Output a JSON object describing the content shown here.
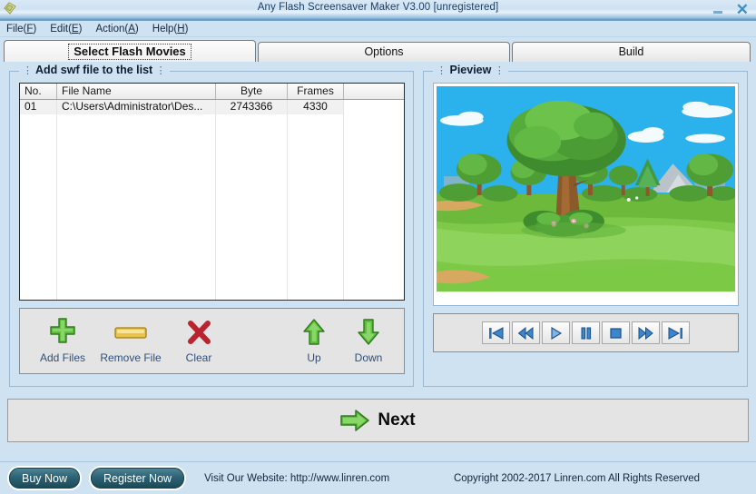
{
  "window": {
    "title": "Any Flash Screensaver Maker V3.00 [unregistered]",
    "app_icon": "app-diamond-icon",
    "minimize_icon": "minimize-icon",
    "close_icon": "close-icon"
  },
  "menubar": {
    "items": [
      {
        "label": "File",
        "accel": "F"
      },
      {
        "label": "Edit",
        "accel": "E"
      },
      {
        "label": "Action",
        "accel": "A"
      },
      {
        "label": "Help",
        "accel": "H"
      }
    ]
  },
  "tabs": [
    {
      "label": "Select Flash Movies",
      "active": true
    },
    {
      "label": "Options",
      "active": false
    },
    {
      "label": "Build",
      "active": false
    }
  ],
  "left_panel": {
    "group_title": "Add swf file to the list",
    "columns": [
      "No.",
      "File Name",
      "Byte",
      "Frames",
      ""
    ],
    "rows": [
      {
        "no": "01",
        "name": "C:\\Users\\Administrator\\Des...",
        "byte": "2743366",
        "frames": "4330"
      }
    ],
    "empty_row_count": 14,
    "toolbar": [
      {
        "label": "Add Files",
        "icon": "green-plus-icon"
      },
      {
        "label": "Remove File",
        "icon": "yellow-minus-icon"
      },
      {
        "label": "Clear",
        "icon": "red-x-icon"
      },
      {
        "label": "Up",
        "icon": "green-up-arrow-icon"
      },
      {
        "label": "Down",
        "icon": "green-down-arrow-icon"
      }
    ]
  },
  "right_panel": {
    "group_title": "Pieview",
    "preview_description": "Cartoon park scene with a large tree on a green lawn under a blue sky",
    "player_buttons": [
      {
        "icon": "skip-to-start-icon",
        "name": "first-frame-button"
      },
      {
        "icon": "rewind-icon",
        "name": "rewind-button"
      },
      {
        "icon": "play-icon",
        "name": "play-button"
      },
      {
        "icon": "pause-icon",
        "name": "pause-button"
      },
      {
        "icon": "stop-icon",
        "name": "stop-button"
      },
      {
        "icon": "fast-forward-icon",
        "name": "fast-forward-button"
      },
      {
        "icon": "skip-to-end-icon",
        "name": "last-frame-button"
      }
    ]
  },
  "next_bar": {
    "label": "Next",
    "icon": "green-right-arrow-icon"
  },
  "statusbar": {
    "buy_label": "Buy Now",
    "register_label": "Register Now",
    "website_text": "Visit Our Website: http://www.linren.com",
    "copyright_text": "Copyright 2002-2017 Linren.com All Rights Reserved"
  },
  "colors": {
    "window_bg": "#cfe2f2",
    "panel_gray": "#e4e4e4",
    "accent_green": "#56b948",
    "accent_red": "#c0242b",
    "player_blue": "#2a6fb5",
    "pill_teal": "#2d6374"
  }
}
